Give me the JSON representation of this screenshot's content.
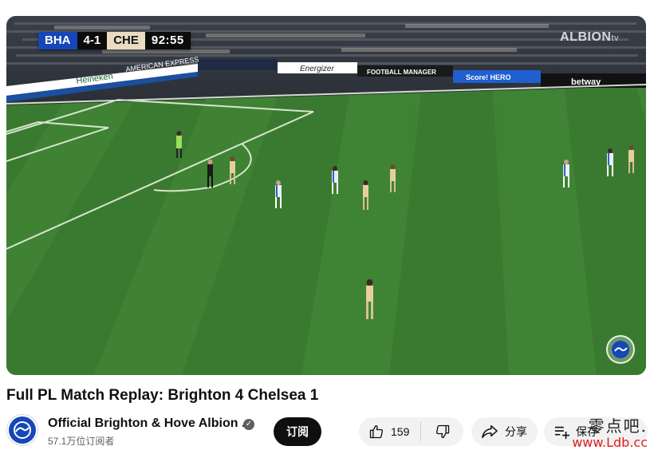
{
  "player": {
    "scorebug": {
      "home": "BHA",
      "score": "4-1",
      "away": "CHE",
      "clock": "92:55"
    },
    "broadcaster": "ALBION",
    "broadcaster_suffix": "tv",
    "boards": [
      "Heineken",
      "AMERICAN EXPRESS",
      "Energizer",
      "FOOTBALL MANAGER",
      "Score! HERO",
      "betway"
    ]
  },
  "video": {
    "title": "Full PL Match Replay: Brighton 4 Chelsea 1"
  },
  "channel": {
    "name": "Official Brighton & Hove Albion ...",
    "subscribers": "57.1万位订阅者",
    "subscribe_label": "订阅"
  },
  "actions": {
    "like_count": "159",
    "share_label": "分享",
    "save_label": "保存"
  },
  "watermark": {
    "text_cn": "零点吧.",
    "url": "www.Ldb.cc"
  },
  "colors": {
    "pitch_light": "#3f7f33",
    "pitch_dark": "#356f2b",
    "home_team": "#1547b8",
    "subscribe_bg": "#0f0f0f",
    "pill_bg": "#f2f2f2",
    "watermark_url": "#e02020"
  }
}
